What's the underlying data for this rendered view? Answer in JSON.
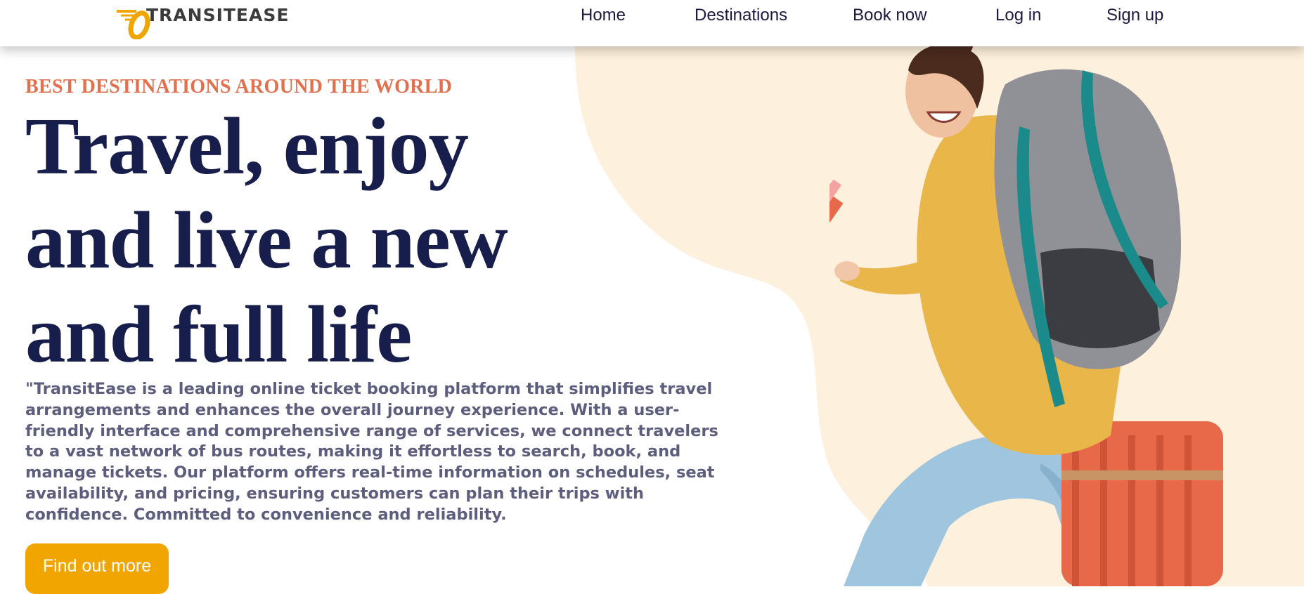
{
  "brand": {
    "name": "TRANSITEASE",
    "logo_icon": "wheel-speed-icon",
    "accent_color": "#f1a501"
  },
  "nav": {
    "items": [
      {
        "label": "Home"
      },
      {
        "label": "Destinations"
      },
      {
        "label": "Book now"
      },
      {
        "label": "Log in"
      },
      {
        "label": "Sign up"
      }
    ]
  },
  "hero": {
    "eyebrow": "BEST DESTINATIONS AROUND THE WORLD",
    "headline_lines": [
      "Travel, enjoy",
      "and live a new",
      "and full life"
    ],
    "description": "\"TransitEase is a leading online ticket booking platform that simplifies travel arrangements and enhances the overall journey experience. With a user-friendly interface and comprehensive range of services, we connect travelers to a vast network of bus routes, making it effortless to search, book, and manage tickets. Our platform offers real-time information on schedules, seat availability, and pricing, ensuring customers can plan their trips with confidence. Committed to convenience and reliability.",
    "cta_label": "Find out more",
    "image": "traveler-with-backpack-and-suitcase",
    "colors": {
      "eyebrow": "#e1704f",
      "headline": "#181e4b",
      "body": "#5d5d7e",
      "blob": "#fdf0dc"
    }
  }
}
